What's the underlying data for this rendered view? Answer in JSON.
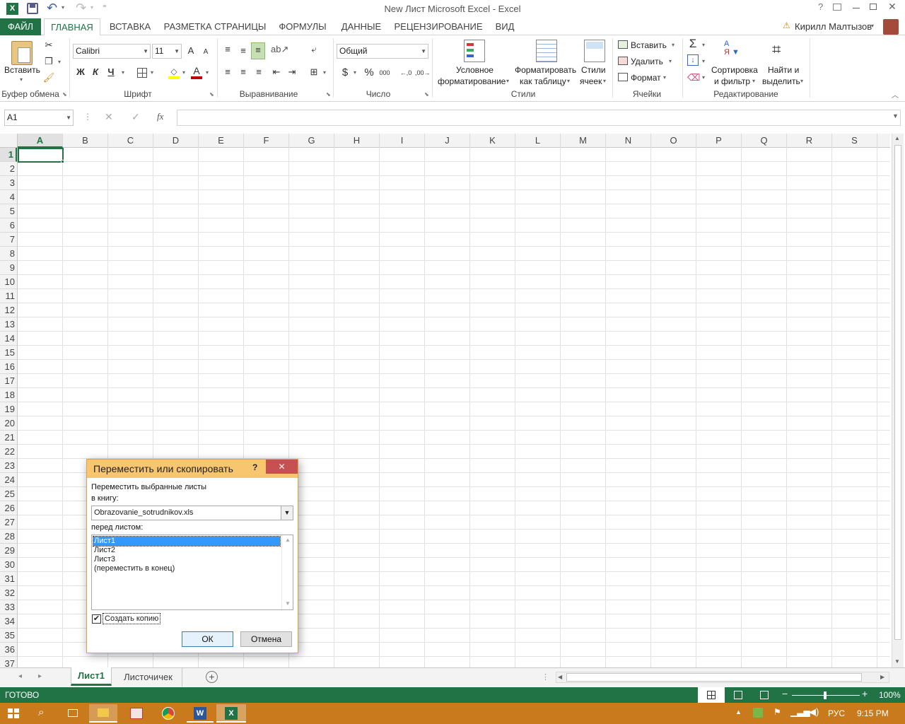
{
  "window": {
    "title": "New Лист Microsoft Excel - Excel",
    "user": "Кирилл Малтызов"
  },
  "qat": {
    "excel_icon": "X",
    "save": "save-icon",
    "undo": "undo-icon",
    "redo": "redo-icon"
  },
  "tabs": [
    {
      "label": "ФАЙЛ"
    },
    {
      "label": "ГЛАВНАЯ"
    },
    {
      "label": "ВСТАВКА"
    },
    {
      "label": "РАЗМЕТКА СТРАНИЦЫ"
    },
    {
      "label": "ФОРМУЛЫ"
    },
    {
      "label": "ДАННЫЕ"
    },
    {
      "label": "РЕЦЕНЗИРОВАНИЕ"
    },
    {
      "label": "ВИД"
    }
  ],
  "ribbon": {
    "clipboard": {
      "paste": "Вставить",
      "group": "Буфер обмена"
    },
    "font": {
      "name": "Calibri",
      "size": "11",
      "bold": "Ж",
      "italic": "К",
      "underline": "Ч",
      "group": "Шрифт",
      "grow": "A",
      "shrink": "A"
    },
    "alignment": {
      "group": "Выравнивание"
    },
    "number": {
      "format": "Общий",
      "currency": "$",
      "percent": "%",
      "thousands": "000",
      "group": "Число"
    },
    "styles": {
      "conditional_1": "Условное",
      "conditional_2": "форматирование",
      "as_table_1": "Форматировать",
      "as_table_2": "как таблицу",
      "cell_styles_1": "Стили",
      "cell_styles_2": "ячеек",
      "group": "Стили"
    },
    "cells": {
      "insert": "Вставить",
      "delete": "Удалить",
      "format": "Формат",
      "group": "Ячейки"
    },
    "editing": {
      "sort_1": "Сортировка",
      "sort_2": "и фильтр",
      "find_1": "Найти и",
      "find_2": "выделить",
      "group": "Редактирование",
      "sigma": "Σ"
    }
  },
  "formula_bar": {
    "name_box": "A1",
    "fx": "fx",
    "cancel": "✕",
    "enter": "✓",
    "value": ""
  },
  "columns": [
    "A",
    "B",
    "C",
    "D",
    "E",
    "F",
    "G",
    "H",
    "I",
    "J",
    "K",
    "L",
    "M",
    "N",
    "O",
    "P",
    "Q",
    "R",
    "S"
  ],
  "rows": [
    "1",
    "2",
    "3",
    "4",
    "5",
    "6",
    "7",
    "8",
    "9",
    "10",
    "11",
    "12",
    "13",
    "14",
    "15",
    "16",
    "17",
    "18",
    "19",
    "20",
    "21",
    "22",
    "23",
    "24",
    "25",
    "26",
    "27",
    "28",
    "29",
    "30",
    "31",
    "32",
    "33",
    "34",
    "35",
    "36",
    "37"
  ],
  "sheets": [
    {
      "label": "Лист1",
      "active": true
    },
    {
      "label": "Листочичек",
      "active": false
    }
  ],
  "status": {
    "ready": "ГОТОВО",
    "zoom": "100%"
  },
  "taskbar": {
    "lang": "РУС",
    "time": "9:15 PM"
  },
  "dialog": {
    "title": "Переместить или скопировать",
    "help": "?",
    "close": "✕",
    "move_label": "Переместить выбранные листы",
    "to_book_label": "в книгу:",
    "book": "Obrazovanie_sotrudnikov.xls",
    "before_label": "перед листом:",
    "list": [
      "Лист1",
      "Лист2",
      "Лист3",
      "(переместить в конец)"
    ],
    "create_copy": "Создать копию",
    "create_copy_checked": true,
    "ok": "ОК",
    "cancel": "Отмена"
  },
  "colors": {
    "excel_green": "#217346",
    "dialog_title": "#f7c66e",
    "selection_blue": "#3399ff",
    "taskbar": "#c87a1c"
  }
}
